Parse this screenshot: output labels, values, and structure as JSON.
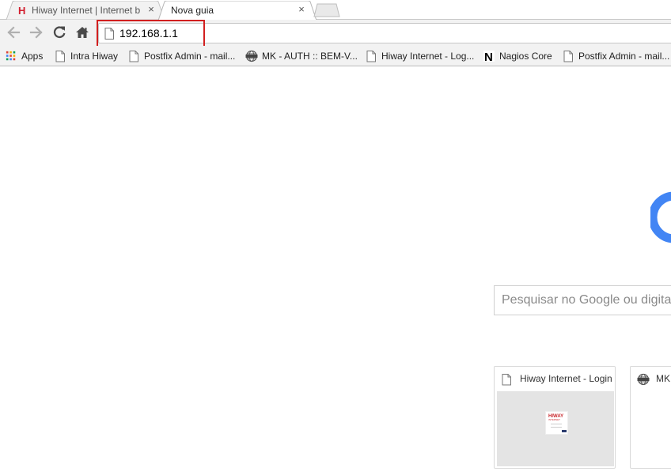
{
  "tabs": [
    {
      "title": "Hiway Internet | Internet b",
      "favicon": "hiway-h-icon",
      "favicon_letter": "H",
      "favicon_color": "#d21f2f",
      "active": false,
      "close": "×"
    },
    {
      "title": "Nova guia",
      "favicon": "",
      "active": true,
      "close": "×"
    }
  ],
  "toolbar": {
    "back": "back-arrow-icon",
    "forward": "forward-arrow-icon",
    "reload": "reload-icon",
    "home": "home-icon",
    "url": "192.168.1.1",
    "highlight_color": "#d21f1f"
  },
  "bookmarks": {
    "apps_label": "Apps",
    "items": [
      {
        "label": "Intra Hiway",
        "icon": "page-icon"
      },
      {
        "label": "Postfix Admin - mail...",
        "icon": "page-icon"
      },
      {
        "label": "MK - AUTH :: BEM-V...",
        "icon": "mk-globe-icon"
      },
      {
        "label": "Hiway Internet - Log...",
        "icon": "page-icon"
      },
      {
        "label": "Nagios Core",
        "icon": "nagios-n-icon",
        "icon_letter": "N"
      },
      {
        "label": "Postfix Admin - mail...",
        "icon": "page-icon"
      }
    ]
  },
  "ntp": {
    "search_placeholder": "Pesquisar no Google ou digitar URL",
    "logo_color": "#4285f4",
    "tiles": [
      {
        "title": "Hiway Internet - Login",
        "icon": "page-icon",
        "thumb_logo_line1": "HIWAY",
        "thumb_logo_line2": "INTERNET"
      },
      {
        "title": "MK - AUTH :: BEM-VINDO",
        "icon": "mk-globe-icon"
      }
    ]
  }
}
